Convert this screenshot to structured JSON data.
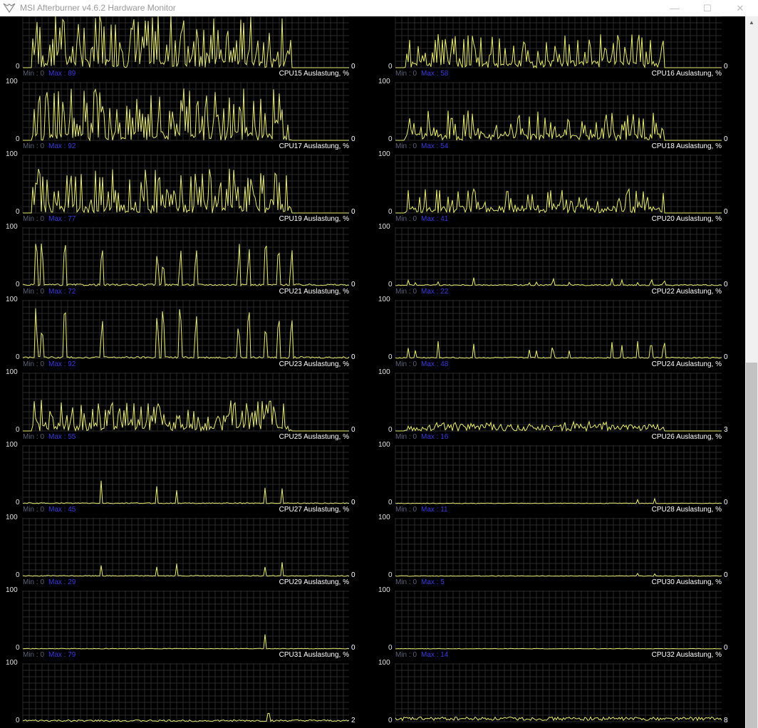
{
  "window": {
    "title": "MSI Afterburner v4.6.2 Hardware Monitor",
    "controls": [
      "—",
      "☐",
      "✕"
    ]
  },
  "scale": {
    "max_label": "100",
    "min_label": "0"
  },
  "stats_labels": {
    "min": "Min : 0",
    "max_prefix": "Max : "
  },
  "colors": {
    "line": "#e8ec74",
    "grid": "#2a2a2a",
    "background": "#000000",
    "max_text": "#3a3ad8"
  },
  "graphs": [
    {
      "name": "CPU15 Auslastung, %",
      "max": "89",
      "current": "0",
      "profile": "high"
    },
    {
      "name": "CPU16 Auslastung, %",
      "max": "58",
      "current": "0",
      "profile": "mid"
    },
    {
      "name": "CPU17 Auslastung, %",
      "max": "92",
      "current": "0",
      "profile": "high"
    },
    {
      "name": "CPU18 Auslastung, %",
      "max": "54",
      "current": "0",
      "profile": "mid"
    },
    {
      "name": "CPU19 Auslastung, %",
      "max": "77",
      "current": "0",
      "profile": "high"
    },
    {
      "name": "CPU20 Auslastung, %",
      "max": "41",
      "current": "0",
      "profile": "mid"
    },
    {
      "name": "CPU21 Auslastung, %",
      "max": "72",
      "current": "0",
      "profile": "spiky"
    },
    {
      "name": "CPU22 Auslastung, %",
      "max": "22",
      "current": "0",
      "profile": "low"
    },
    {
      "name": "CPU23 Auslastung, %",
      "max": "92",
      "current": "0",
      "profile": "spiky"
    },
    {
      "name": "CPU24 Auslastung, %",
      "max": "48",
      "current": "0",
      "profile": "low"
    },
    {
      "name": "CPU25 Auslastung, %",
      "max": "55",
      "current": "0",
      "profile": "high"
    },
    {
      "name": "CPU26 Auslastung, %",
      "max": "16",
      "current": "3",
      "profile": "mid"
    },
    {
      "name": "CPU27 Auslastung, %",
      "max": "45",
      "current": "0",
      "profile": "sparse"
    },
    {
      "name": "CPU28 Auslastung, %",
      "max": "11",
      "current": "0",
      "profile": "tiny"
    },
    {
      "name": "CPU29 Auslastung, %",
      "max": "29",
      "current": "0",
      "profile": "sparse"
    },
    {
      "name": "CPU30 Auslastung, %",
      "max": "5",
      "current": "0",
      "profile": "tiny"
    },
    {
      "name": "CPU31 Auslastung, %",
      "max": "79",
      "current": "0",
      "profile": "single"
    },
    {
      "name": "CPU32 Auslastung, %",
      "max": "14",
      "current": "0",
      "profile": "flat"
    },
    {
      "name": "",
      "max": "",
      "current": "2",
      "profile": "noise"
    },
    {
      "name": "",
      "max": "",
      "current": "8",
      "profile": "noise2"
    }
  ]
}
